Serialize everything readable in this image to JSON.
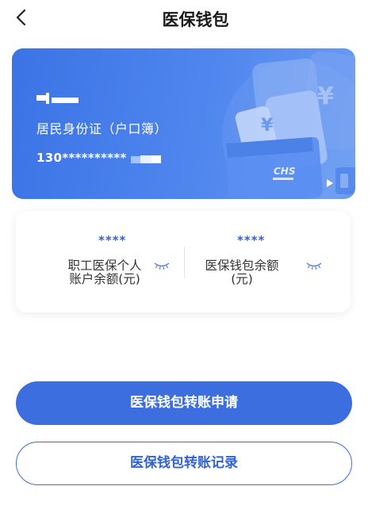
{
  "header": {
    "title": "医保钱包",
    "back_icon": "chevron-left-icon"
  },
  "card": {
    "id_type": "居民身份证（户口簿）",
    "id_number": "130**********",
    "logo_text": "CHS",
    "colors": {
      "gradient_start": "#3b73e6",
      "gradient_end": "#6b9cf3"
    }
  },
  "balances": [
    {
      "value": "****",
      "label_line1": "职工医保个人",
      "label_line2": "账户余额(元)",
      "icon": "eye-closed-icon"
    },
    {
      "value": "****",
      "label_line1": "医保钱包余额",
      "label_line2": "(元)",
      "icon": "eye-closed-icon"
    }
  ],
  "actions": {
    "transfer_apply_label": "医保钱包转账申请",
    "transfer_record_label": "医保钱包转账记录"
  },
  "theme": {
    "accent": "#3d6ee0",
    "stars_color": "#2f63d8"
  }
}
